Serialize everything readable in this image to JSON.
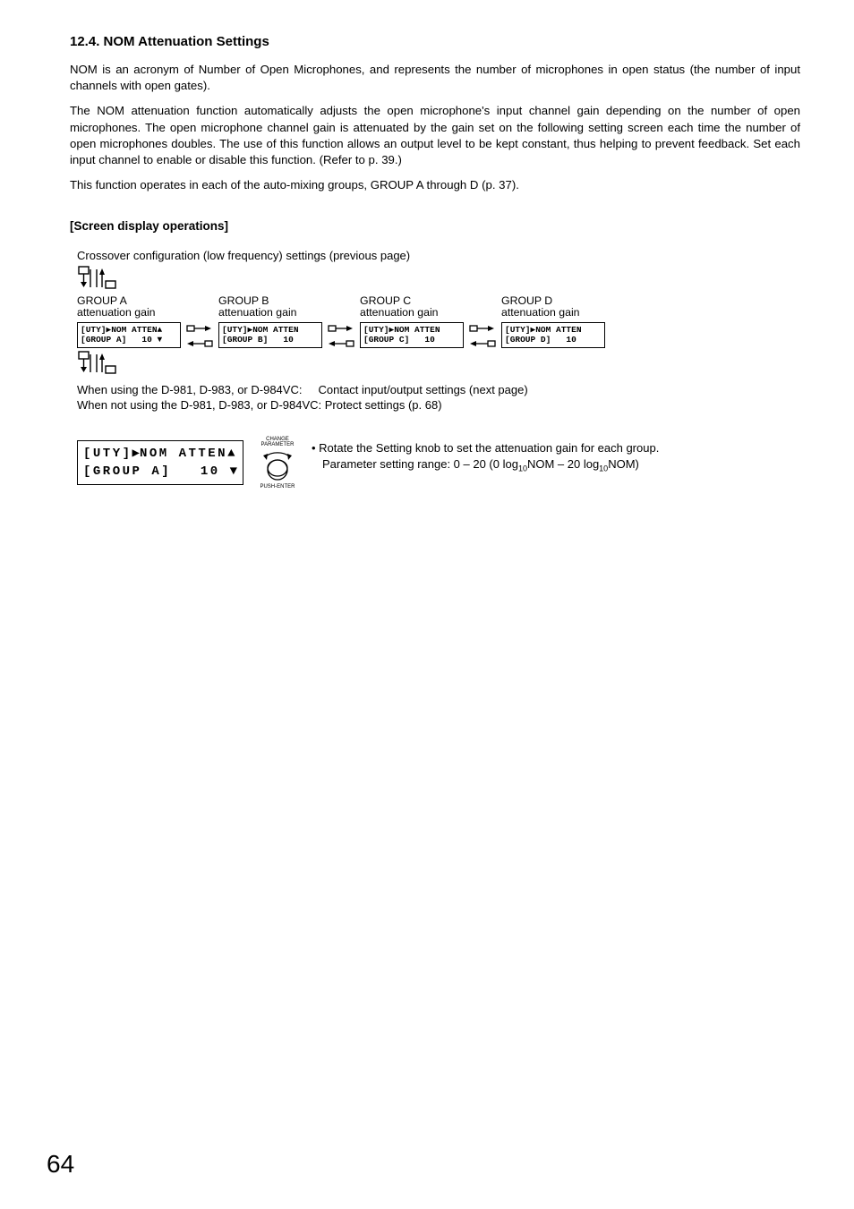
{
  "section_number": "12.4.",
  "section_title": "NOM Attenuation Settings",
  "paragraph1": "NOM is an acronym of Number of Open Microphones, and represents the number of microphones in open status (the number of input channels with open gates).",
  "paragraph2": "The NOM attenuation function automatically adjusts the open microphone's input channel gain depending on the number of open microphones. The open microphone channel gain is attenuated by the gain set on the following setting screen each time the number of open microphones doubles. The use of this function allows an output level to be kept constant, thus helping to prevent feedback. Set each input channel to enable or disable this function. (Refer to p. 39.)",
  "paragraph3": "This function operates in each of the auto-mixing groups, GROUP A through D (p. 37).",
  "subhead": "[Screen display operations]",
  "crossover_note": "Crossover configuration (low frequency) settings (previous page)",
  "groups": [
    {
      "title": "GROUP A",
      "sub": "attenuation gain",
      "lcd_line1": "[UTY]▶NOM ATTEN▲",
      "lcd_line2": "[GROUP A]   10 ▼"
    },
    {
      "title": "GROUP B",
      "sub": "attenuation gain",
      "lcd_line1": "[UTY]▶NOM ATTEN",
      "lcd_line2": "[GROUP B]   10"
    },
    {
      "title": "GROUP C",
      "sub": "attenuation gain",
      "lcd_line1": "[UTY]▶NOM ATTEN",
      "lcd_line2": "[GROUP C]   10"
    },
    {
      "title": "GROUP D",
      "sub": "attenuation gain",
      "lcd_line1": "[UTY]▶NOM ATTEN",
      "lcd_line2": "[GROUP D]   10"
    }
  ],
  "after_flow_1a": "When using the D-981, D-983, or D-984VC:",
  "after_flow_1b": "Contact input/output settings (next page)",
  "after_flow_2": "When not using the D-981, D-983, or D-984VC: Protect settings (p. 68)",
  "big_lcd_line1_left": "[UTY]",
  "big_lcd_line1_mid": "NOM",
  "big_lcd_line1_right": "ATTEN",
  "big_lcd_line2_left": "[GROUP",
  "big_lcd_line2_mid": "A]",
  "big_lcd_line2_right": "10",
  "knob_top1": "CHANGE",
  "knob_top2": "PARAMETER",
  "knob_bottom": "PUSH-ENTER",
  "bullet_text": "Rotate the Setting knob to set the attenuation gain for each group.",
  "bullet_sub_pre": "Parameter setting range: 0 – 20 (0 log",
  "bullet_sub_mid": "NOM – 20 log",
  "bullet_sub_post": "NOM)",
  "log_sub": "10",
  "page_number": "64"
}
